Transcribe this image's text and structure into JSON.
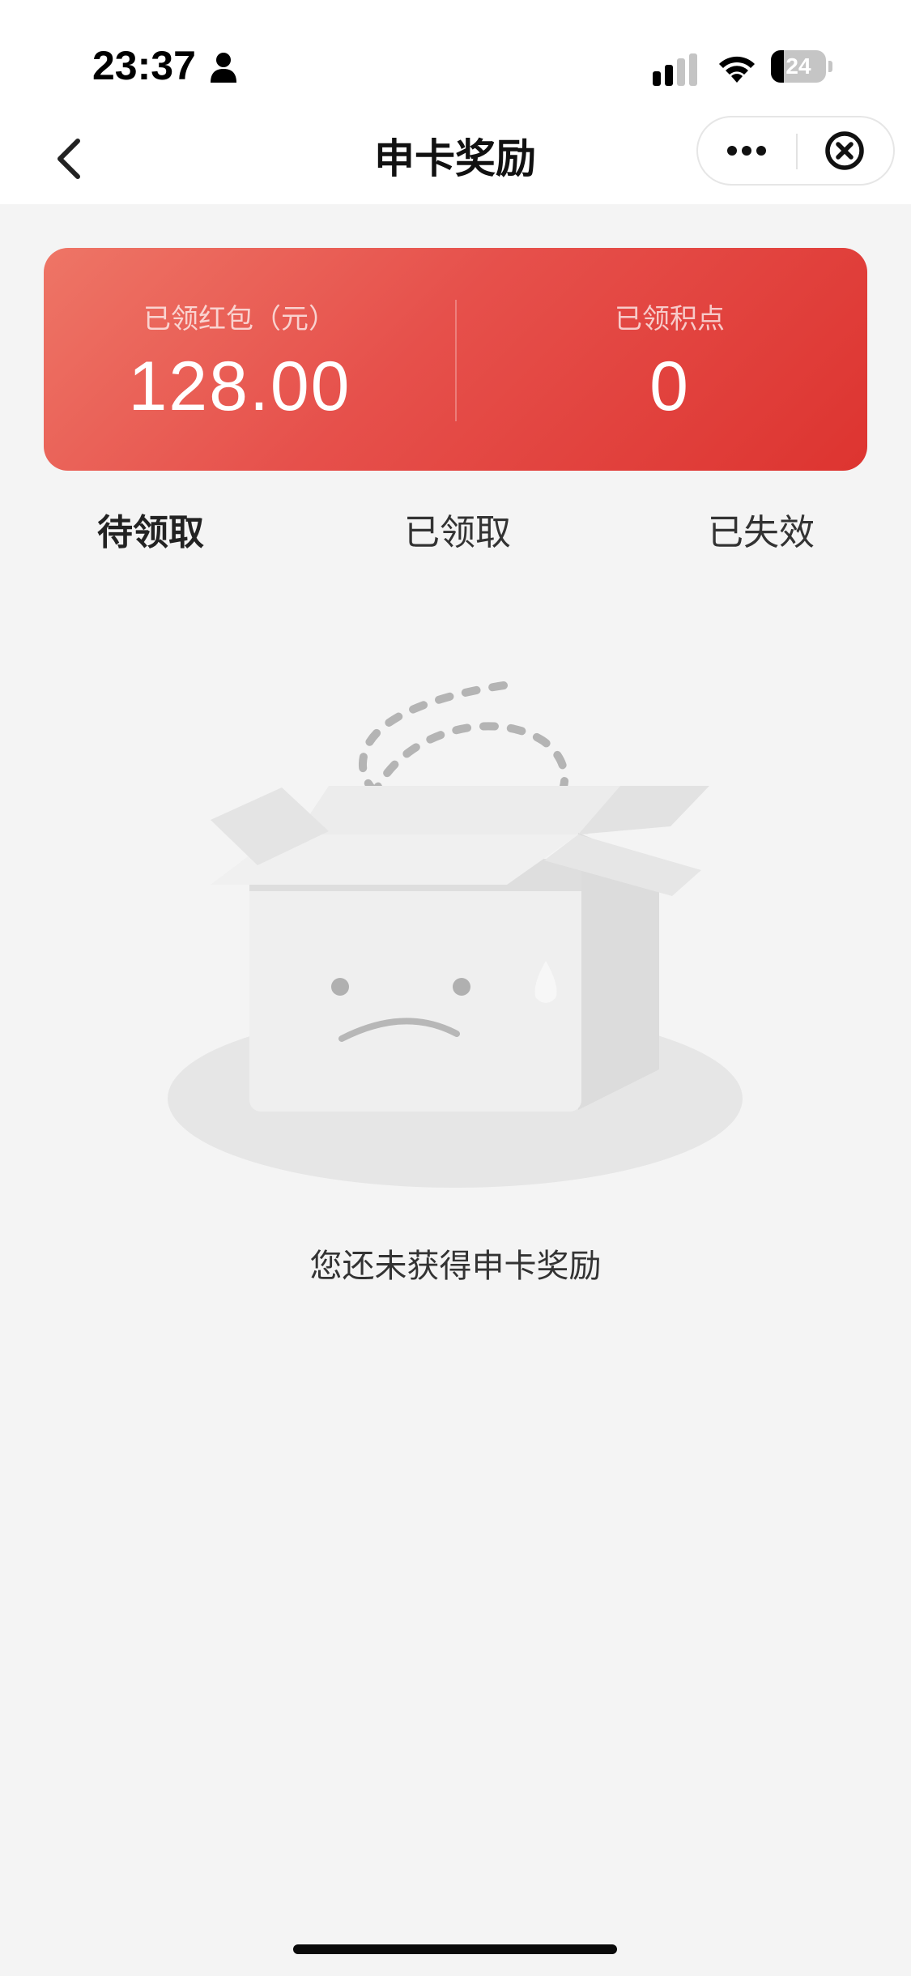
{
  "status_bar": {
    "time": "23:37",
    "battery_level": "24",
    "battery_fraction": 0.24
  },
  "nav": {
    "title": "申卡奖励",
    "back_icon": "chevron-left-icon",
    "more_icon": "more-dots-icon",
    "close_icon": "close-circle-icon"
  },
  "summary": {
    "red_packet_label": "已领红包（元）",
    "red_packet_value": "128.00",
    "points_label": "已领积点",
    "points_value": "0",
    "gradient_colors": [
      "#ee7566",
      "#dd3430"
    ]
  },
  "tabs": [
    {
      "label": "待领取",
      "active": true
    },
    {
      "label": "已领取",
      "active": false
    },
    {
      "label": "已失效",
      "active": false
    }
  ],
  "empty_state": {
    "illustration": "sad-empty-box-icon",
    "message": "您还未获得申卡奖励"
  }
}
